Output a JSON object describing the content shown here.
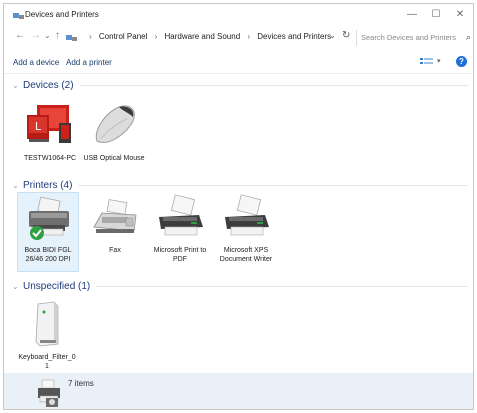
{
  "window": {
    "title": "Devices and Printers",
    "controls": {
      "minimize": "—",
      "maximize": "☐",
      "close": "✕"
    }
  },
  "address": {
    "crumbs": [
      "Control Panel",
      "Hardware and Sound",
      "Devices and Printers"
    ],
    "separator": "›",
    "dropdown": "⌄",
    "refresh": "↻",
    "search_placeholder": "Search Devices and Printers",
    "search_icon": "⌕"
  },
  "nav": {
    "back": "←",
    "forward": "→",
    "recent": "⌄",
    "up": "↑"
  },
  "commands": {
    "add_device": "Add a device",
    "add_printer": "Add a printer",
    "view_drop": "▾",
    "help": "?"
  },
  "groups": {
    "devices": {
      "title": "Devices (2)",
      "items": [
        {
          "label": "TESTW1064-PC",
          "icon": "computer-icon"
        },
        {
          "label": "USB Optical Mouse",
          "icon": "mouse-icon"
        }
      ]
    },
    "printers": {
      "title": "Printers (4)",
      "items": [
        {
          "label": "Boca BIDI FGL 26/46 200 DPI",
          "icon": "printer-default-icon"
        },
        {
          "label": "Fax",
          "icon": "fax-icon"
        },
        {
          "label": "Microsoft Print to PDF",
          "icon": "printer-icon"
        },
        {
          "label": "Microsoft XPS Document Writer",
          "icon": "printer-icon"
        }
      ]
    },
    "unspecified": {
      "title": "Unspecified (1)",
      "items": [
        {
          "label": "Keyboard_Filter_0 1",
          "icon": "unspecified-device-icon"
        }
      ]
    }
  },
  "group_chevron": "⌄",
  "status": {
    "text": "7 items"
  },
  "colors": {
    "accent": "#1e6fd6",
    "group_title": "#1e3a7a",
    "status_bg": "#e9f0f8",
    "default_badge": "#2ea043"
  }
}
